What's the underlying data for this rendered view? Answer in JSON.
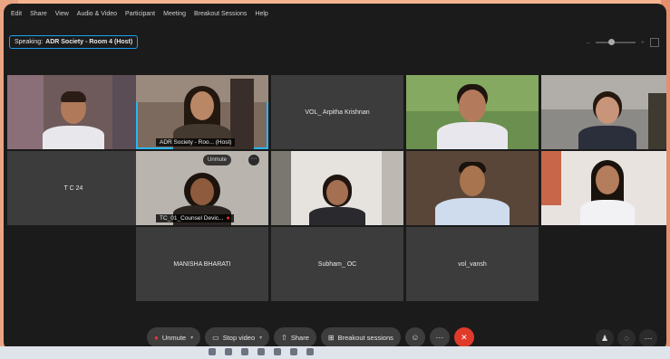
{
  "menu": [
    "Edit",
    "Share",
    "View",
    "Audio & Video",
    "Participant",
    "Meeting",
    "Breakout Sessions",
    "Help"
  ],
  "speaking": {
    "label": "Speaking:",
    "name": "ADR Society - Room 4 (Host)"
  },
  "tiles": {
    "p1": {
      "name": ""
    },
    "p2": {
      "name": "ADR Society - Roo... (Host)"
    },
    "p3": {
      "name": "VOL_ Arpitha Krishnan"
    },
    "p4": {
      "name": ""
    },
    "p5": {
      "name": ""
    },
    "p6": {
      "name": "T C 24"
    },
    "p7": {
      "name": "TC_01_Counsel Devic...",
      "unmute": "Unmute",
      "more": "···"
    },
    "p8": {
      "name": ""
    },
    "p9": {
      "name": ""
    },
    "p10": {
      "name": ""
    },
    "p11": {
      "name": "MANISHA BHARATI"
    },
    "p12": {
      "name": "Subham_ OC"
    },
    "p13": {
      "name": "vol_vansh"
    }
  },
  "controls": {
    "unmute": "Unmute",
    "stop_video": "Stop video",
    "share": "Share",
    "breakout": "Breakout sessions"
  },
  "colors": {
    "accent": "#1aa0f0",
    "leave": "#e03a2a"
  }
}
